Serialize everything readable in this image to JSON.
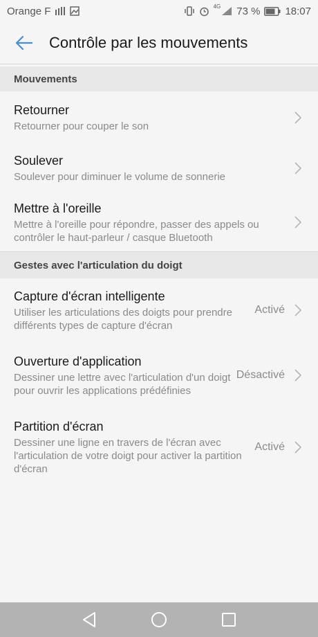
{
  "status_bar": {
    "carrier": "Orange F",
    "battery": "73 %",
    "time": "18:07",
    "network": "4G"
  },
  "app_bar": {
    "title": "Contrôle par les mouvements"
  },
  "sections": [
    {
      "header": "Mouvements",
      "items": [
        {
          "title": "Retourner",
          "subtitle": "Retourner pour couper le son",
          "status": ""
        },
        {
          "title": "Soulever",
          "subtitle": "Soulever pour diminuer le volume de sonnerie",
          "status": ""
        },
        {
          "title": "Mettre à l'oreille",
          "subtitle": "Mettre à l'oreille pour répondre, passer des appels ou contrôler le haut-parleur / casque Bluetooth",
          "status": ""
        }
      ]
    },
    {
      "header": "Gestes avec l'articulation du doigt",
      "items": [
        {
          "title": "Capture d'écran intelligente",
          "subtitle": "Utiliser les articulations des doigts pour prendre différents types de capture d'écran",
          "status": "Activé"
        },
        {
          "title": "Ouverture d'application",
          "subtitle": "Dessiner une lettre avec l'articulation d'un doigt pour ouvrir les applications prédéfinies",
          "status": "Désactivé"
        },
        {
          "title": "Partition d'écran",
          "subtitle": "Dessiner une ligne en travers de l'écran avec l'articulation de votre doigt pour activer la partition d'écran",
          "status": "Activé"
        }
      ]
    }
  ],
  "colors": {
    "accent": "#4a8fd1",
    "background": "#f5f5f5",
    "section_bg": "#e8e8e8",
    "navbar_bg": "#b3b3b3"
  }
}
